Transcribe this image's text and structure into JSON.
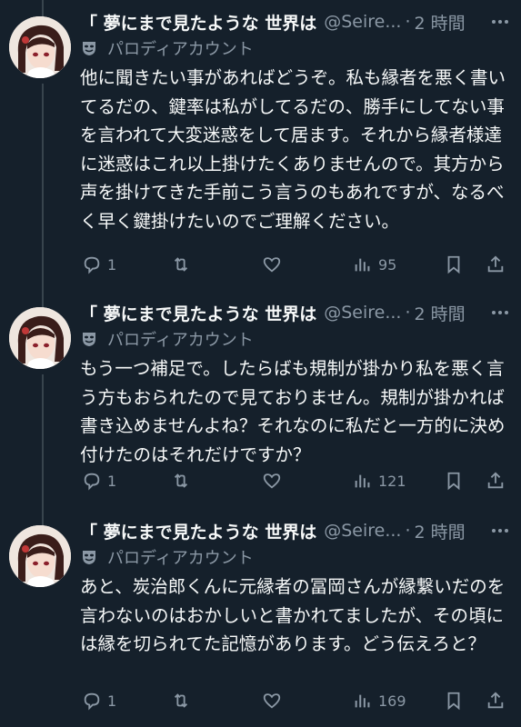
{
  "tweets": [
    {
      "name": "「 夢にまで見たような 世界は",
      "handle": "@Seire...",
      "separator": "·",
      "time": "2 時間",
      "parody_label": "パロディアカウント",
      "text": "他に聞きたい事があればどうぞ。私も縁者を悪く書いてるだの、鍵率は私がしてるだの、勝手にしてない事を言われて大変迷惑をして居ます。それから縁者様達に迷惑はこれ以上掛けたくありませんので。其方から声を掛けてきた手前こう言うのもあれですが、なるべく早く鍵掛けたいのでご理解ください。",
      "reply_count": "1",
      "view_count": "95"
    },
    {
      "name": "「 夢にまで見たような 世界は",
      "handle": "@Seire...",
      "separator": "·",
      "time": "2 時間",
      "parody_label": "パロディアカウント",
      "text": "もう一つ補足で。したらばも規制が掛かり私を悪く言う方もおられたので見ておりません。規制が掛かれば書き込めませんよね？それなのに私だと一方的に決め付けたのはそれだけですか？",
      "reply_count": "1",
      "view_count": "121"
    },
    {
      "name": "「 夢にまで見たような 世界は",
      "handle": "@Seire...",
      "separator": "·",
      "time": "2 時間",
      "parody_label": "パロディアカウント",
      "text": "あと、炭治郎くんに元縁者の冨岡さんが縁繋いだのを言わないのはおかしいと書かれてましたが、その頃には縁を切られてた記憶があります。どう伝えろと？",
      "reply_count": "1",
      "view_count": "169"
    }
  ],
  "colors": {
    "background": "#15202b",
    "text": "#f7f9f9",
    "muted": "#8b98a5",
    "thread_line": "#38444d"
  },
  "icons": [
    "reply-icon",
    "retweet-icon",
    "like-icon",
    "views-icon",
    "bookmark-icon",
    "share-icon",
    "more-icon",
    "parody-mask-icon"
  ]
}
